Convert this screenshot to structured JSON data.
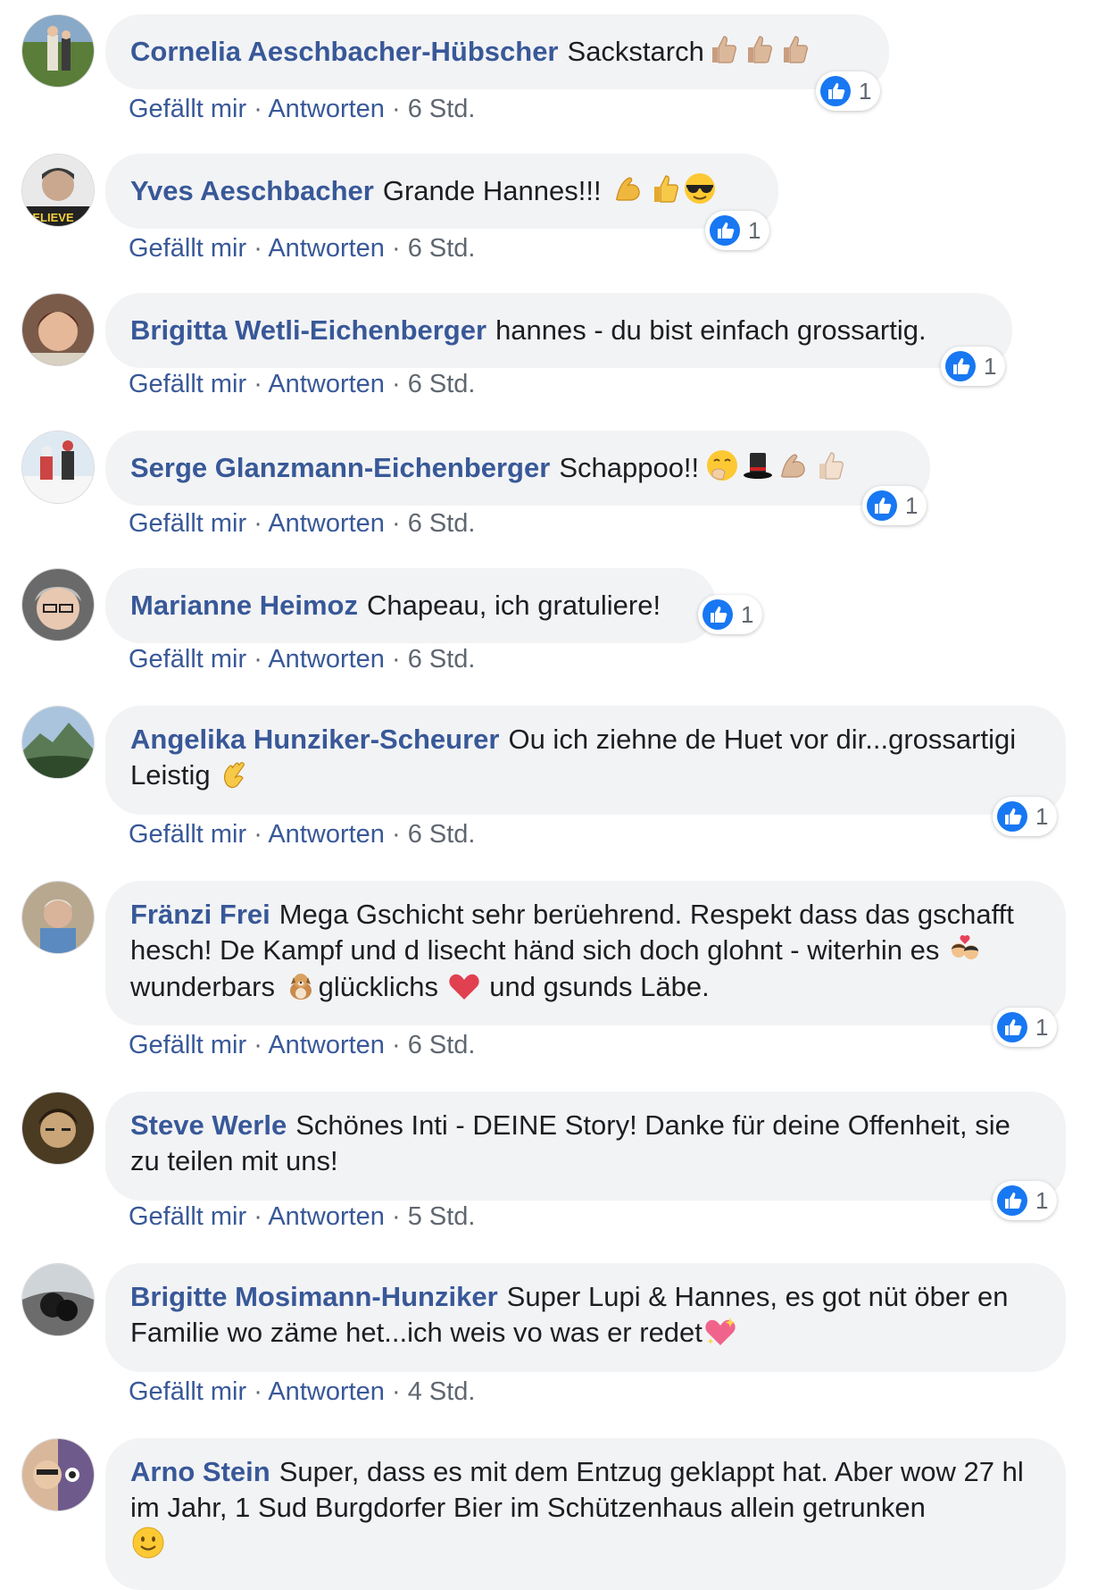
{
  "labels": {
    "like": "Gefällt mir",
    "reply": "Antworten",
    "separator": "·"
  },
  "colors": {
    "author": "#385898",
    "bubble": "#f2f3f5",
    "like_blue": "#1877f2",
    "meta_gray": "#606770"
  },
  "comments": [
    {
      "author": "Cornelia Aeschbacher-Hübscher",
      "text": "Sackstarch",
      "emojis_after": [
        "thumbs-up-icon",
        "thumbs-up-icon",
        "thumbs-up-icon"
      ],
      "time": "6 Std.",
      "likes": "1"
    },
    {
      "author": "Yves Aeschbacher",
      "text": "Grande Hannes!!!",
      "emojis_after": [
        "flexed-biceps-icon",
        "thumbs-up-icon",
        "sunglasses-face-icon"
      ],
      "time": "6 Std.",
      "likes": "1"
    },
    {
      "author": "Brigitta Wetli-Eichenberger",
      "text": "hannes - du bist einfach grossartig.",
      "emojis_after": [],
      "time": "6 Std.",
      "likes": "1"
    },
    {
      "author": "Serge Glanzmann-Eichenberger",
      "text": "Schappoo!!",
      "emojis_after": [
        "giggling-face-icon",
        "top-hat-icon",
        "flexed-biceps-icon",
        "thumbs-up-icon"
      ],
      "time": "6 Std.",
      "likes": "1"
    },
    {
      "author": "Marianne Heimoz",
      "text": "Chapeau, ich gratuliere!",
      "emojis_after": [],
      "time": "6 Std.",
      "likes": "1"
    },
    {
      "author": "Angelika Hunziker-Scheurer",
      "text": "Ou ich ziehne de Huet vor dir...grossartigi Leistig",
      "emojis_after": [
        "clapping-hands-icon"
      ],
      "time": "6 Std.",
      "likes": "1"
    },
    {
      "author": "Fränzi Frei",
      "text_parts": [
        "Mega Gschicht sehr berüehrend. Respekt dass das gschafft hesch! De Kampf und d lisecht händ sich doch glohnt - witerhin es",
        "wunderbars",
        "glücklichs",
        "und gsunds Läbe."
      ],
      "emojis_between": [
        "couple-with-heart-icon",
        "dog-icon",
        "red-heart-icon"
      ],
      "time": "6 Std.",
      "likes": "1"
    },
    {
      "author": "Steve Werle",
      "text": "Schönes Inti - DEINE Story! Danke für deine Offenheit, sie zu teilen mit uns!",
      "emojis_after": [],
      "time": "5 Std.",
      "likes": "1"
    },
    {
      "author": "Brigitte Mosimann-Hunziker",
      "text": "Super Lupi & Hannes, es got nüt öber en Familie wo zäme het...ich weis vo was er redet",
      "emojis_after": [
        "sparkling-heart-icon"
      ],
      "time": "4 Std.",
      "likes": ""
    },
    {
      "author": "Arno Stein",
      "text": "Super, dass es mit dem Entzug geklappt hat. Aber wow 27 hl im Jahr, 1 Sud Burgdorfer Bier im Schützenhaus allein getrunken",
      "emojis_after": [
        "smiling-face-icon"
      ],
      "time": "",
      "likes": ""
    }
  ]
}
